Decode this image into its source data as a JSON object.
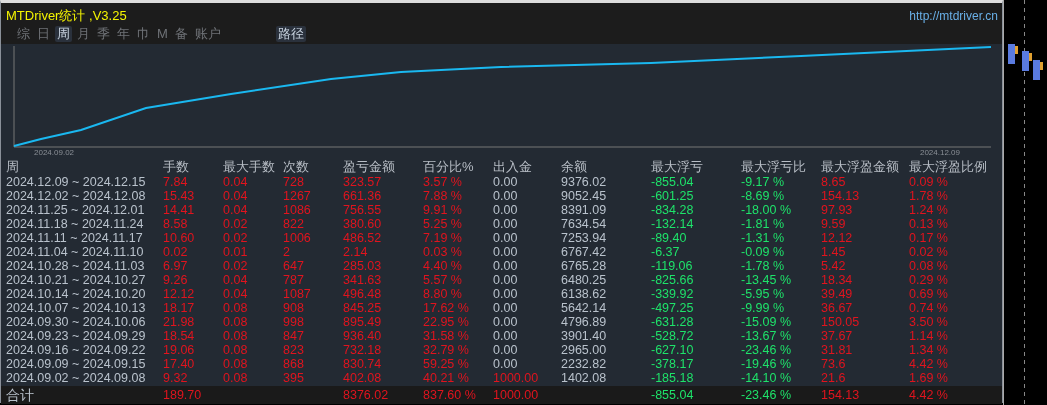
{
  "window": {
    "title": "MTDriver统计 ,V3.25",
    "url": "http://mtdriver.cn"
  },
  "tabs": [
    {
      "label": "综",
      "selected": false
    },
    {
      "label": "日",
      "selected": false
    },
    {
      "label": "周",
      "selected": true
    },
    {
      "label": "月",
      "selected": false
    },
    {
      "label": "季",
      "selected": false
    },
    {
      "label": "年",
      "selected": false
    },
    {
      "label": "巾",
      "selected": false
    },
    {
      "label": "M",
      "selected": false
    },
    {
      "label": "备",
      "selected": false
    },
    {
      "label": "账户",
      "selected": false
    }
  ],
  "path_button": {
    "label": "路径",
    "selected": true
  },
  "chart": {
    "x_start": "2024.09.02",
    "x_end": "2024.12.09"
  },
  "table": {
    "columns": [
      {
        "label": "周",
        "kind": "date"
      },
      {
        "label": "手数",
        "kind": "red"
      },
      {
        "label": "最大手数",
        "kind": "red"
      },
      {
        "label": "次数",
        "kind": "red"
      },
      {
        "label": "盈亏金额",
        "kind": "red"
      },
      {
        "label": "百分比%",
        "kind": "red"
      },
      {
        "label": "出入金",
        "kind": "flow"
      },
      {
        "label": "余额",
        "kind": "plain"
      },
      {
        "label": "最大浮亏",
        "kind": "green"
      },
      {
        "label": "最大浮亏比",
        "kind": "green"
      },
      {
        "label": "最大浮盈金额",
        "kind": "red"
      },
      {
        "label": "最大浮盈比例",
        "kind": "red"
      }
    ],
    "rows": [
      {
        "cash_flow": false,
        "cells": [
          "2024.12.09 ~ 2024.12.15",
          "7.84",
          "0.04",
          "728",
          "323.57",
          "3.57 %",
          "0.00",
          "9376.02",
          "-855.04",
          "-9.17 %",
          "8.65",
          "0.09 %"
        ]
      },
      {
        "cash_flow": false,
        "cells": [
          "2024.12.02 ~ 2024.12.08",
          "15.43",
          "0.04",
          "1267",
          "661.36",
          "7.88 %",
          "0.00",
          "9052.45",
          "-601.25",
          "-8.69 %",
          "154.13",
          "1.78 %"
        ]
      },
      {
        "cash_flow": false,
        "cells": [
          "2024.11.25 ~ 2024.12.01",
          "14.41",
          "0.04",
          "1086",
          "756.55",
          "9.91 %",
          "0.00",
          "8391.09",
          "-834.28",
          "-18.00 %",
          "97.93",
          "1.24 %"
        ]
      },
      {
        "cash_flow": false,
        "cells": [
          "2024.11.18 ~ 2024.11.24",
          "8.58",
          "0.02",
          "822",
          "380.60",
          "5.25 %",
          "0.00",
          "7634.54",
          "-132.14",
          "-1.81 %",
          "9.59",
          "0.13 %"
        ]
      },
      {
        "cash_flow": false,
        "cells": [
          "2024.11.11 ~ 2024.11.17",
          "10.60",
          "0.02",
          "1006",
          "486.52",
          "7.19 %",
          "0.00",
          "7253.94",
          "-89.40",
          "-1.31 %",
          "12.12",
          "0.17 %"
        ]
      },
      {
        "cash_flow": false,
        "cells": [
          "2024.11.04 ~ 2024.11.10",
          "0.02",
          "0.01",
          "2",
          "2.14",
          "0.03 %",
          "0.00",
          "6767.42",
          "-6.37",
          "-0.09 %",
          "1.45",
          "0.02 %"
        ]
      },
      {
        "cash_flow": false,
        "cells": [
          "2024.10.28 ~ 2024.11.03",
          "6.97",
          "0.02",
          "647",
          "285.03",
          "4.40 %",
          "0.00",
          "6765.28",
          "-119.06",
          "-1.78 %",
          "5.42",
          "0.08 %"
        ]
      },
      {
        "cash_flow": false,
        "cells": [
          "2024.10.21 ~ 2024.10.27",
          "9.26",
          "0.04",
          "787",
          "341.63",
          "5.57 %",
          "0.00",
          "6480.25",
          "-825.66",
          "-13.45 %",
          "18.34",
          "0.29 %"
        ]
      },
      {
        "cash_flow": false,
        "cells": [
          "2024.10.14 ~ 2024.10.20",
          "12.12",
          "0.04",
          "1087",
          "496.48",
          "8.80 %",
          "0.00",
          "6138.62",
          "-339.92",
          "-5.95 %",
          "39.49",
          "0.69 %"
        ]
      },
      {
        "cash_flow": false,
        "cells": [
          "2024.10.07 ~ 2024.10.13",
          "18.17",
          "0.08",
          "908",
          "845.25",
          "17.62 %",
          "0.00",
          "5642.14",
          "-497.25",
          "-9.99 %",
          "36.67",
          "0.74 %"
        ]
      },
      {
        "cash_flow": false,
        "cells": [
          "2024.09.30 ~ 2024.10.06",
          "21.98",
          "0.08",
          "998",
          "895.49",
          "22.95 %",
          "0.00",
          "4796.89",
          "-631.28",
          "-15.09 %",
          "150.05",
          "3.50 %"
        ]
      },
      {
        "cash_flow": false,
        "cells": [
          "2024.09.23 ~ 2024.09.29",
          "18.54",
          "0.08",
          "847",
          "936.40",
          "31.58 %",
          "0.00",
          "3901.40",
          "-528.72",
          "-13.67 %",
          "37.67",
          "1.14 %"
        ]
      },
      {
        "cash_flow": false,
        "cells": [
          "2024.09.16 ~ 2024.09.22",
          "19.06",
          "0.08",
          "823",
          "732.18",
          "32.79 %",
          "0.00",
          "2965.00",
          "-627.10",
          "-23.46 %",
          "31.81",
          "1.34 %"
        ]
      },
      {
        "cash_flow": false,
        "cells": [
          "2024.09.09 ~ 2024.09.15",
          "17.40",
          "0.08",
          "868",
          "830.74",
          "59.25 %",
          "0.00",
          "2232.82",
          "-378.17",
          "-19.46 %",
          "73.6",
          "4.42 %"
        ]
      },
      {
        "cash_flow": true,
        "cells": [
          "2024.09.02 ~ 2024.09.08",
          "9.32",
          "0.08",
          "395",
          "402.08",
          "40.21 %",
          "1000.00",
          "1402.08",
          "-185.18",
          "-14.10 %",
          "21.6",
          "1.69 %"
        ]
      }
    ],
    "total": {
      "cash_flow": true,
      "cells": [
        "合计",
        "189.70",
        null,
        null,
        "8376.02",
        "837.60 %",
        "1000.00",
        null,
        "-855.04",
        "-23.46 %",
        "154.13",
        "4.42 %"
      ]
    }
  }
}
